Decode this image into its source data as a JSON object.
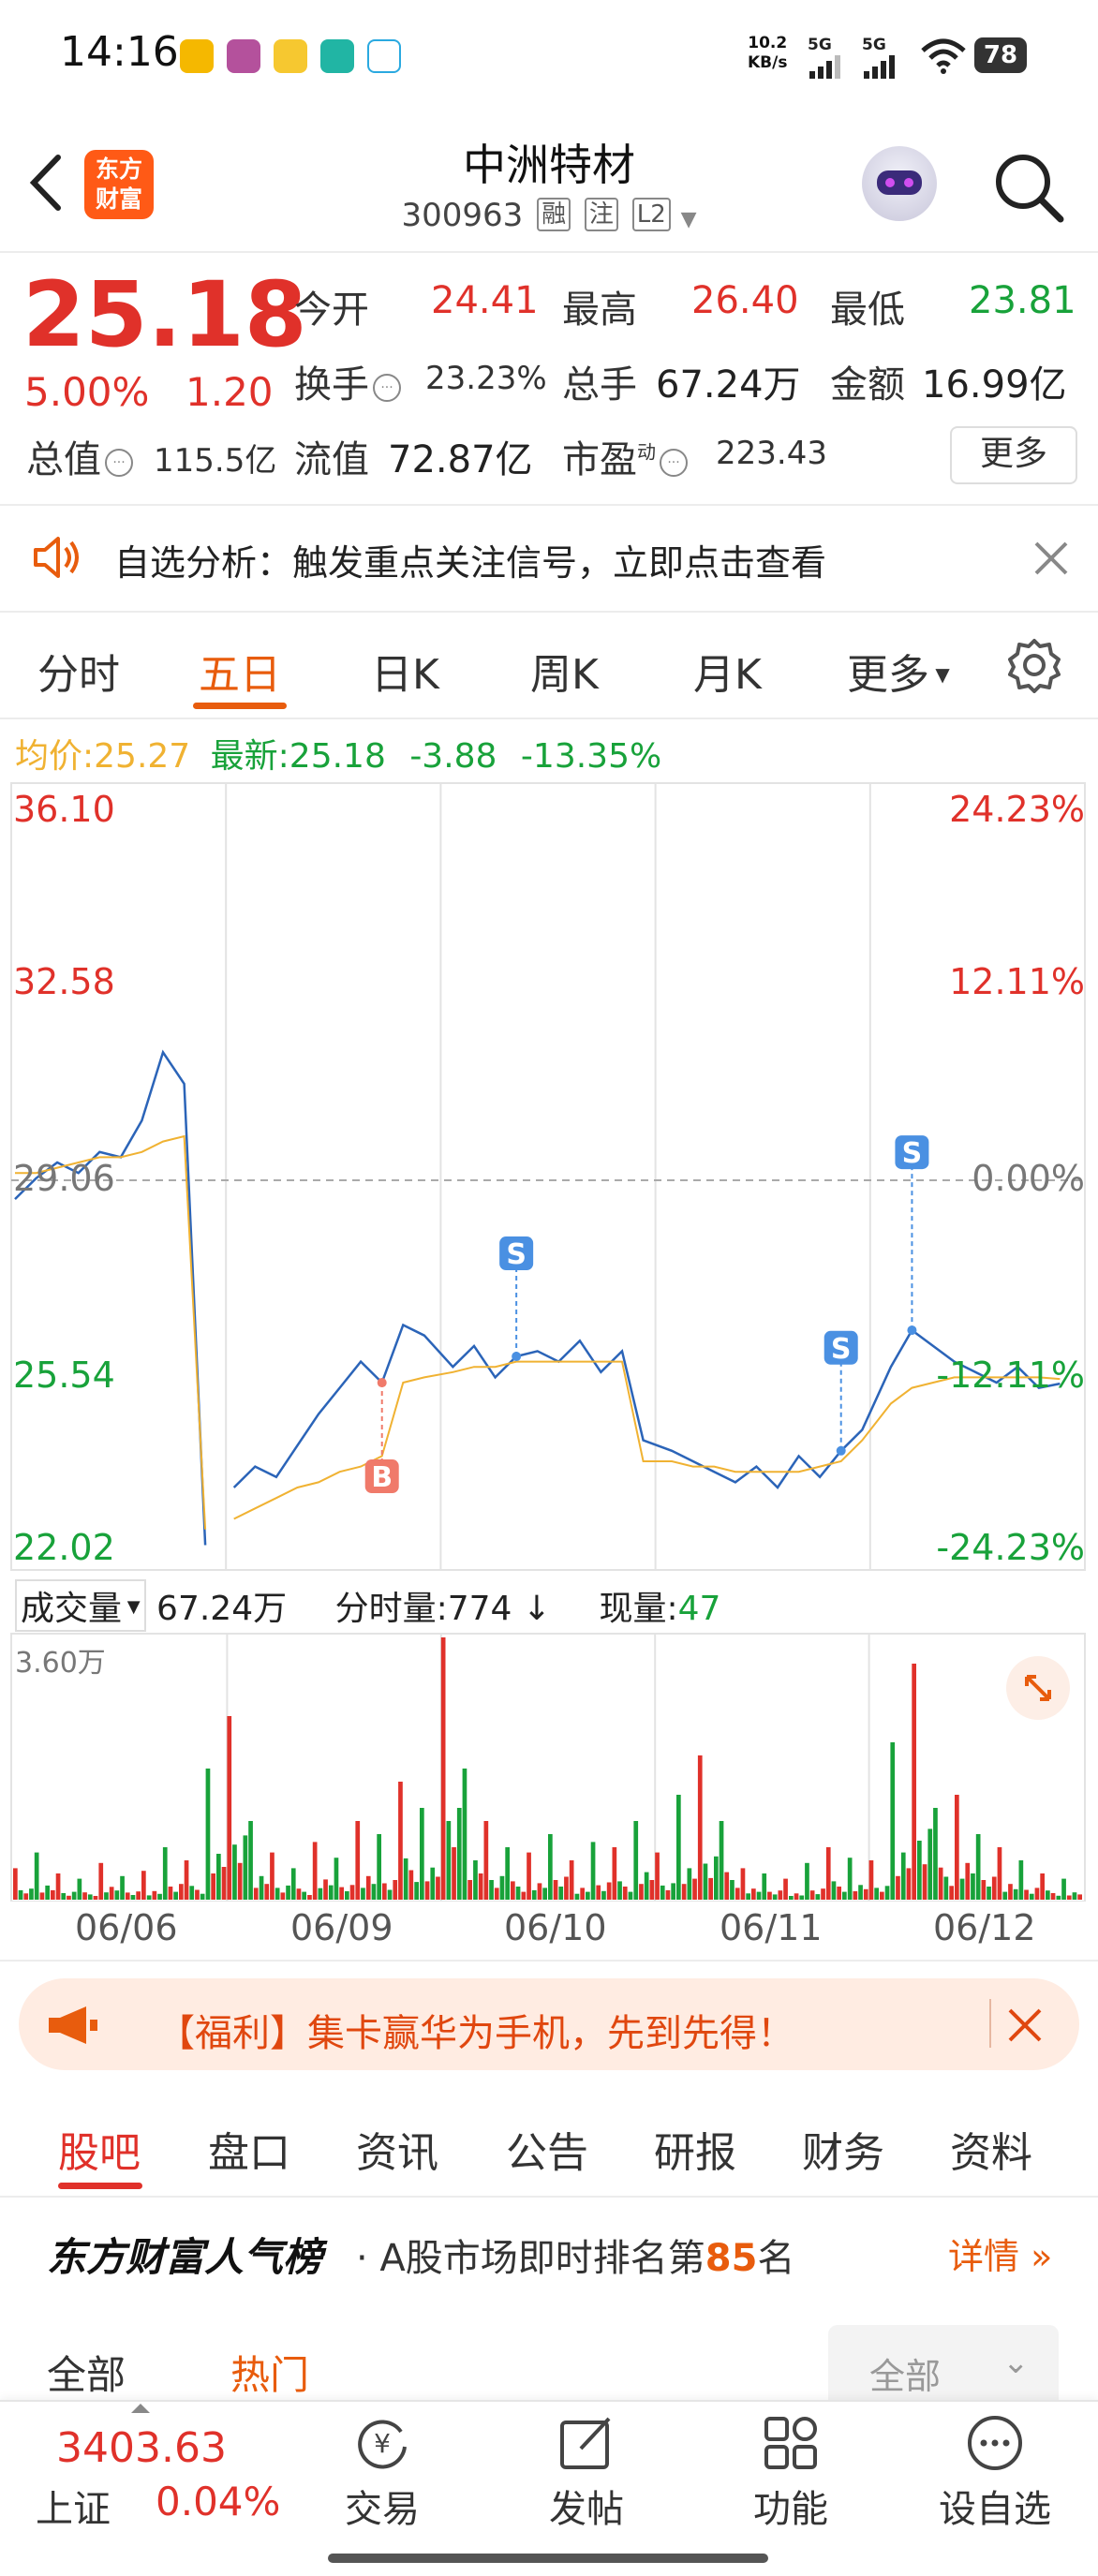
{
  "status_bar": {
    "time": "14:16",
    "net_speed_top": "10.2",
    "net_speed_bottom": "KB/s",
    "signal1": "5G",
    "signal2": "5G",
    "battery": "78"
  },
  "header": {
    "logo_line1": "东方",
    "logo_line2": "财富",
    "stock_name": "中洲特材",
    "stock_code": "300963",
    "tags": [
      "融",
      "注",
      "L2"
    ]
  },
  "quote": {
    "price": "25.18",
    "change_pct": "5.00%",
    "change": "1.20",
    "open_label": "今开",
    "open": "24.41",
    "high_label": "最高",
    "high": "26.40",
    "low_label": "最低",
    "low": "23.81",
    "turnover_label": "换手",
    "turnover": "23.23%",
    "volume_label": "总手",
    "volume": "67.24万",
    "amount_label": "金额",
    "amount": "16.99亿",
    "mktcap_label": "总值",
    "mktcap": "115.5亿",
    "float_label": "流值",
    "float": "72.87亿",
    "pe_label": "市盈",
    "pe_sup": "动",
    "pe": "223.43",
    "more_label": "更多"
  },
  "notice": {
    "text": "自选分析：触发重点关注信号，立即点击查看"
  },
  "chart_tabs": [
    "分时",
    "五日",
    "日K",
    "周K",
    "月K",
    "更多"
  ],
  "legend": {
    "avg_label": "均价:",
    "avg": "25.27",
    "latest_label": "最新:",
    "latest": "25.18",
    "chg": "-3.88",
    "chg_pct": "-13.35%"
  },
  "chart_data": {
    "type": "line",
    "title": "",
    "x": [
      "06/06",
      "06/09",
      "06/10",
      "06/11",
      "06/12"
    ],
    "y_left_ticks": [
      "36.10",
      "32.58",
      "29.06",
      "25.54",
      "22.02"
    ],
    "y_right_ticks": [
      "24.23%",
      "12.11%",
      "0.00%",
      "-12.11%",
      "-24.23%"
    ],
    "ylim": [
      22.02,
      36.1
    ],
    "series": [
      {
        "values": [
          28.7,
          29.1,
          29.4,
          29.2,
          29.6,
          29.5,
          30.2,
          31.5,
          30.9,
          22.1,
          23.2,
          23.6,
          23.4,
          24.0,
          24.6,
          25.1,
          25.6,
          25.2,
          26.3,
          26.1,
          25.5,
          25.9,
          25.3,
          25.7,
          25.8,
          25.6,
          26.0,
          25.4,
          25.8,
          24.1,
          23.9,
          23.7,
          23.5,
          23.3,
          23.6,
          23.2,
          23.8,
          23.4,
          23.9,
          24.3,
          25.5,
          26.2,
          25.9,
          25.6,
          25.4,
          25.2,
          25.5,
          25.1,
          25.18
        ]
      },
      {
        "values": [
          29.2,
          29.2,
          29.3,
          29.4,
          29.5,
          29.5,
          29.6,
          29.8,
          29.9,
          22.4,
          22.6,
          22.8,
          23.0,
          23.2,
          23.3,
          23.5,
          23.6,
          23.8,
          25.2,
          25.3,
          25.4,
          25.5,
          25.5,
          25.6,
          25.6,
          25.6,
          25.6,
          25.6,
          25.6,
          23.7,
          23.7,
          23.6,
          23.6,
          23.5,
          23.5,
          23.5,
          23.5,
          23.6,
          23.7,
          24.1,
          24.8,
          25.1,
          25.2,
          25.3,
          25.3,
          25.3,
          25.3,
          25.3,
          25.27
        ]
      }
    ],
    "markers": [
      {
        "label": "B",
        "day": "06/09",
        "kind": "buy"
      },
      {
        "label": "S",
        "day": "06/10",
        "kind": "sell"
      },
      {
        "label": "S",
        "day": "06/11",
        "kind": "sell"
      },
      {
        "label": "S",
        "day": "06/11",
        "kind": "sell"
      }
    ],
    "baseline": 29.06,
    "grid": true
  },
  "volume": {
    "label": "成交量",
    "value": "67.24万",
    "tick_label": "分时量:774",
    "now_label": "现量:",
    "now": "47",
    "max_label": "3.60万",
    "bars": [
      0.12,
      0.18,
      0.1,
      0.08,
      0.14,
      0.09,
      0.11,
      0.2,
      0.15,
      0.5,
      0.7,
      0.3,
      0.18,
      0.12,
      0.22,
      0.16,
      0.3,
      0.25,
      0.45,
      0.35,
      1.0,
      0.5,
      0.3,
      0.2,
      0.18,
      0.25,
      0.15,
      0.22,
      0.2,
      0.3,
      0.18,
      0.4,
      0.55,
      0.3,
      0.12,
      0.1,
      0.08,
      0.14,
      0.2,
      0.16,
      0.15,
      0.6,
      0.9,
      0.35,
      0.4,
      0.25,
      0.2,
      0.15,
      0.1,
      0.08
    ]
  },
  "dates": [
    "06/06",
    "06/09",
    "06/10",
    "06/11",
    "06/12"
  ],
  "promo": {
    "text": "【福利】集卡赢华为手机，先到先得！"
  },
  "section_tabs": [
    "股吧",
    "盘口",
    "资讯",
    "公告",
    "研报",
    "财务",
    "资料"
  ],
  "ranking": {
    "title": "东方财富人气榜",
    "sub_pre": "· A股市场即时排名第",
    "rank": "85",
    "sub_post": "名",
    "detail": "详情"
  },
  "filters": {
    "all": "全部",
    "hot": "热门",
    "dropdown": "全部"
  },
  "bottom_nav": {
    "index_value": "3403.63",
    "index_name": "上证",
    "index_pct": "0.04%",
    "items": [
      "交易",
      "发帖",
      "功能",
      "设自选"
    ]
  }
}
